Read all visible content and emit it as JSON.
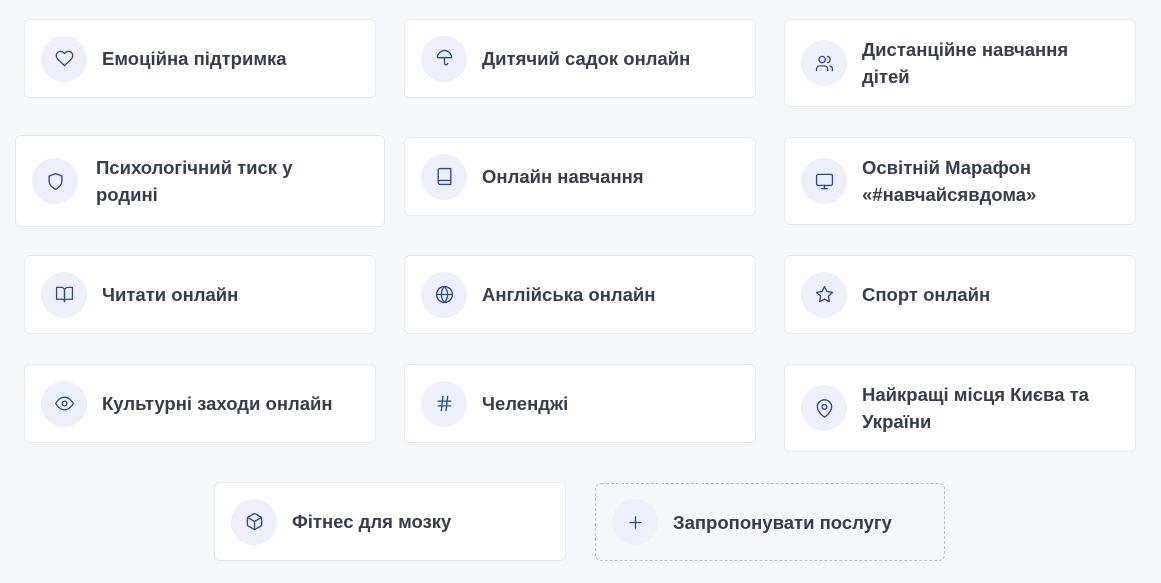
{
  "services": [
    {
      "label": "Емоційна підтримка",
      "icon": "heart-icon"
    },
    {
      "label": "Дитячий садок онлайн",
      "icon": "umbrella-icon"
    },
    {
      "label": "Дистанційне навчання дітей",
      "icon": "users-icon"
    },
    {
      "label": "Психологічний тиск у родині",
      "icon": "shield-icon"
    },
    {
      "label": "Онлайн навчання",
      "icon": "book-icon"
    },
    {
      "label": "Освітній Марафон «#навчайсявдома»",
      "icon": "monitor-icon"
    },
    {
      "label": "Читати онлайн",
      "icon": "open-book-icon"
    },
    {
      "label": "Англійська онлайн",
      "icon": "globe-icon"
    },
    {
      "label": "Спорт онлайн",
      "icon": "star-icon"
    },
    {
      "label": "Культурні заходи онлайн",
      "icon": "eye-icon"
    },
    {
      "label": "Челенджі",
      "icon": "hash-icon"
    },
    {
      "label": "Найкращі місця Києва та України",
      "icon": "map-pin-icon"
    },
    {
      "label": "Фітнес для мозку",
      "icon": "box-icon"
    }
  ],
  "suggest": {
    "label": "Запропонувати послугу",
    "icon": "plus-icon"
  }
}
